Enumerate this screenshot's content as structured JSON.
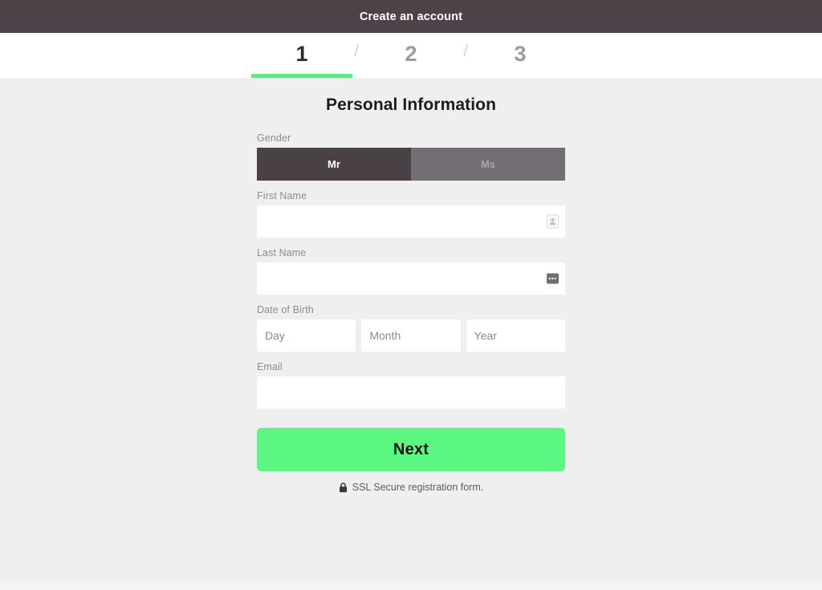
{
  "window": {
    "title": "Create an account",
    "titlebar_bg": "#4c4248"
  },
  "stepper": {
    "steps": [
      {
        "number": "1",
        "state": "active"
      },
      {
        "number": "2",
        "state": "inactive"
      },
      {
        "number": "3",
        "state": "inactive"
      }
    ],
    "separator": "/",
    "active_underline_color": "#67e383"
  },
  "form": {
    "heading": "Personal Information",
    "gender": {
      "label": "Gender",
      "options": [
        {
          "label": "Mr",
          "selected": true
        },
        {
          "label": "Ms",
          "selected": false
        }
      ],
      "selected_bg": "#4a4147",
      "unselected_bg": "#736e73"
    },
    "first_name": {
      "label": "First Name",
      "value": "",
      "placeholder": "",
      "icon": "contact-card-icon"
    },
    "last_name": {
      "label": "Last Name",
      "value": "",
      "placeholder": "",
      "icon": "autofill-suggestion-icon"
    },
    "date_of_birth": {
      "label": "Date of Birth",
      "day": {
        "value": "",
        "placeholder": "Day"
      },
      "month": {
        "value": "",
        "placeholder": "Month"
      },
      "year": {
        "value": "",
        "placeholder": "Year"
      }
    },
    "email": {
      "label": "Email",
      "value": "",
      "placeholder": ""
    },
    "submit": {
      "label": "Next",
      "color": "#5cf783"
    },
    "security_note": {
      "icon": "lock-icon",
      "text": "SSL Secure registration form."
    }
  },
  "theme": {
    "page_bg": "#efefef",
    "input_bg": "#ffffff",
    "label_color": "#8d8d8d"
  }
}
